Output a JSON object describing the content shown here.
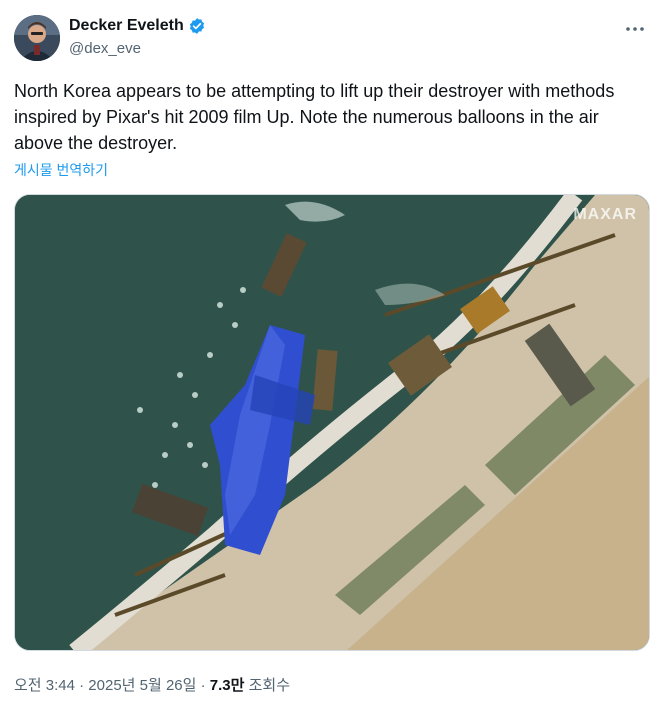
{
  "author": {
    "display_name": "Decker Eveleth",
    "handle": "@dex_eve",
    "verified": true
  },
  "more_icon": "more-horizontal-icon",
  "tweet": {
    "text": "North Korea appears to be attempting to lift up their destroyer with methods inspired by Pixar's hit 2009 film Up. Note the numerous balloons in the air above the destroyer.",
    "translate_label": "게시물 번역하기"
  },
  "media": {
    "watermark": "MAXAR"
  },
  "meta": {
    "timestamp": "오전 3:44 · 2025년 5월 26일 · ",
    "views_count": "7.3만",
    "views_label": " 조회수"
  },
  "colors": {
    "accent": "#1d9bf0",
    "secondary_text": "#536471",
    "water": "#2e5048",
    "tarp_blue": "#2f4fd0",
    "land": "#c9b89a"
  }
}
